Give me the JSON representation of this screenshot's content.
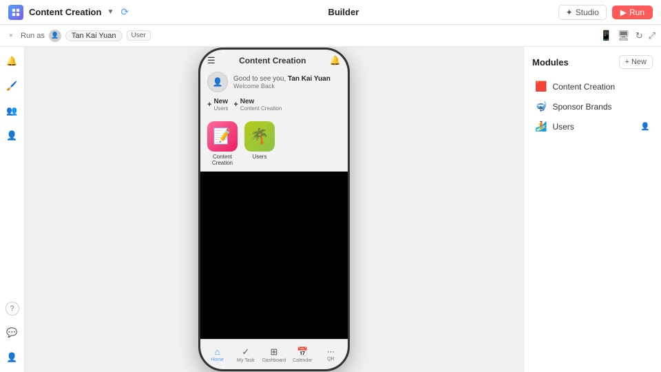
{
  "topbar": {
    "app_name": "Content Creation",
    "center_title": "Builder",
    "studio_label": "Studio",
    "run_label": "Run",
    "chevron": "▼",
    "sync_icon": "✓"
  },
  "subbar": {
    "run_as_label": "Run as",
    "user_name": "Tan Kai Yuan",
    "user_badge": "User",
    "close_icon": "×"
  },
  "device_controls": {
    "mobile_icon": "📱",
    "desktop_icon": "🖥",
    "refresh_icon": "↻",
    "expand_icon": "⤢"
  },
  "phone": {
    "header_title": "Content Creation",
    "welcome_greeting": "Good to see you,",
    "welcome_name": "Tan Kai Yuan",
    "welcome_sub": "Welcome Back",
    "new_btn1_label": "+ New",
    "new_btn1_sub": "Users",
    "new_btn2_label": "+ New",
    "new_btn2_sub": "Content Creation",
    "icon1_emoji": "🟥",
    "icon1_label": "Content\nCreation",
    "icon2_emoji": "🌴",
    "icon2_label": "Users",
    "nav_items": [
      {
        "icon": "⌂",
        "label": "Home",
        "active": true
      },
      {
        "icon": "✓",
        "label": "My Task",
        "active": false
      },
      {
        "icon": "⊞",
        "label": "Dashboard",
        "active": false
      },
      {
        "icon": "📅",
        "label": "Calendar",
        "active": false
      },
      {
        "icon": "⋯",
        "label": "QR",
        "active": false
      }
    ]
  },
  "modules_panel": {
    "title": "Modules",
    "new_label": "+ New",
    "items": [
      {
        "icon": "🟥",
        "label": "Content Creation",
        "has_user": false
      },
      {
        "icon": "🤿",
        "label": "Sponsor Brands",
        "has_user": false
      },
      {
        "icon": "🏄",
        "label": "Users",
        "has_user": true
      }
    ]
  },
  "left_sidebar": {
    "icons": [
      {
        "name": "notifications-icon",
        "symbol": "🔔"
      },
      {
        "name": "brush-icon",
        "symbol": "🖌",
        "active": true
      },
      {
        "name": "users-icon",
        "symbol": "👥"
      },
      {
        "name": "user-add-icon",
        "symbol": "👤+"
      },
      {
        "name": "help-icon",
        "symbol": "?"
      },
      {
        "name": "discord-icon",
        "symbol": "💬"
      },
      {
        "name": "profile-icon",
        "symbol": "👤"
      }
    ]
  }
}
